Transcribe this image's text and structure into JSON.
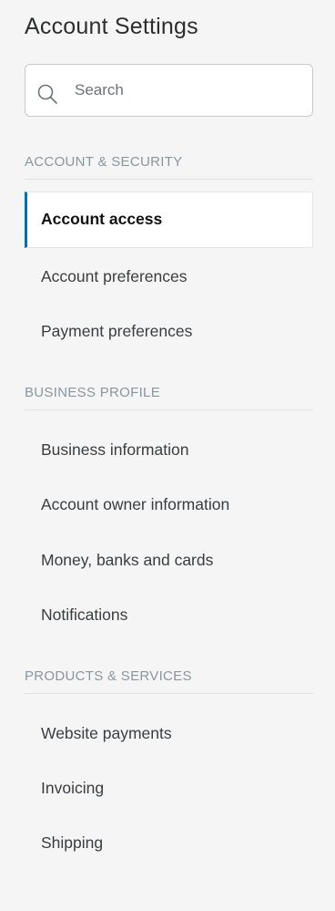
{
  "title": "Account Settings",
  "search": {
    "placeholder": "Search",
    "value": "",
    "icon": "search-icon"
  },
  "sections": [
    {
      "heading": "ACCOUNT & SECURITY",
      "items": [
        {
          "label": "Account access",
          "active": true
        },
        {
          "label": "Account preferences",
          "active": false
        },
        {
          "label": "Payment preferences",
          "active": false
        }
      ]
    },
    {
      "heading": "BUSINESS PROFILE",
      "items": [
        {
          "label": "Business information",
          "active": false
        },
        {
          "label": "Account owner information",
          "active": false
        },
        {
          "label": "Money, banks and cards",
          "active": false
        },
        {
          "label": "Notifications",
          "active": false
        }
      ]
    },
    {
      "heading": "PRODUCTS & SERVICES",
      "items": [
        {
          "label": "Website payments",
          "active": false
        },
        {
          "label": "Invoicing",
          "active": false
        },
        {
          "label": "Shipping",
          "active": false
        }
      ]
    }
  ],
  "colors": {
    "active_indicator": "#0070ba",
    "section_heading": "#8a969e",
    "background": "#f5f5f5"
  }
}
